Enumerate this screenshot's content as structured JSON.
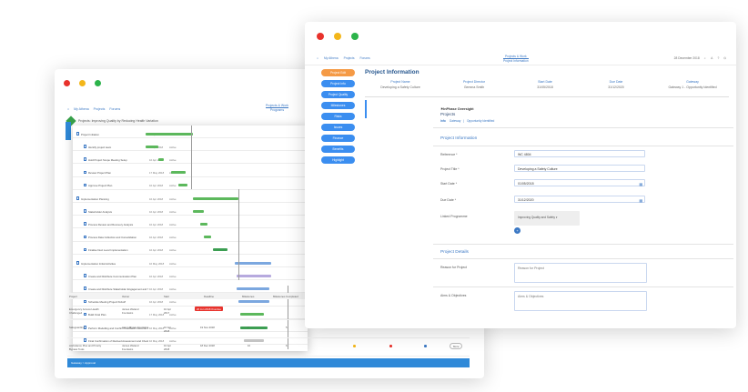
{
  "back_window": {
    "nav": [
      "My Athena",
      "Projects",
      "Forums"
    ],
    "nav_center": [
      "Projects & Work",
      "Programs"
    ],
    "title": "Projects: Improving Quality by Reducing Health Variation",
    "gantt_rows": [
      {
        "name": "Project Initiation",
        "date": "10 Apr 2018",
        "status": "Active",
        "level": 1
      },
      {
        "name": "Identify project team",
        "date": "10 Apr 2018",
        "status": "Active",
        "level": 2
      },
      {
        "name": "Hold Project Scope Meeting Setup",
        "date": "10 Apr 2018",
        "status": "Active",
        "level": 2
      },
      {
        "name": "Review Project Plan",
        "date": "17 May 2018",
        "status": "Active",
        "level": 2
      },
      {
        "name": "Approve Project Plan",
        "date": "10 Apr 2018",
        "status": "Active",
        "level": 2
      },
      {
        "name": "Implementation Planning",
        "date": "10 Apr 2018",
        "status": "Active",
        "level": 1
      },
      {
        "name": "Stakeholder Analysis",
        "date": "10 Apr 2018",
        "status": "Active",
        "level": 2
      },
      {
        "name": "Process Review and Recovery Analysis",
        "date": "10 Apr 2018",
        "status": "Active",
        "level": 2
      },
      {
        "name": "Process Data Collection and Consolidation",
        "date": "10 Apr 2018",
        "status": "Active",
        "level": 2
      },
      {
        "name": "Finalise Next Level Implementation",
        "date": "10 Apr 2018",
        "status": "Active",
        "level": 2
      },
      {
        "name": "Implementation Initial Activities",
        "date": "10 May 2018",
        "status": "Active",
        "level": 1
      },
      {
        "name": "Create and Distribute Communication Plan",
        "date": "10 Apr 2018",
        "status": "Active",
        "level": 2
      },
      {
        "name": "Create and Distribute Stakeholder Engagement and Sign-off of Current State Level Outline",
        "date": "10 Apr 2018",
        "status": "Active",
        "level": 2
      },
      {
        "name": "Schedule Meeting Project Kickoff",
        "date": "10 Apr 2018",
        "status": "Active",
        "level": 2
      },
      {
        "name": "Build Final Plan",
        "date": "17 May 2018",
        "status": "Active",
        "level": 2
      },
      {
        "name": "Perform Modelling and Confirm Feedback Outcome Provided",
        "date": "10 May 2018",
        "status": "Active",
        "level": 2
      },
      {
        "name": "Final Confirmation of Revised Assessment and Check",
        "date": "10 May 2018",
        "status": "Active",
        "level": 2
      }
    ],
    "table_headers": [
      "Project",
      "Owner",
      "Start",
      "Deadline",
      "Milestones",
      "Milestones Completed"
    ],
    "table_rows": [
      {
        "project": "Emergency Access Health Challenged",
        "owner": "James Weland Fountains",
        "start": "10 Apr 2017",
        "deadline": "20 Jun 2018 Overdue",
        "milestones": "",
        "completed": ""
      },
      {
        "project": "Safeguarding",
        "owner": "Aaron Brown Fountains",
        "start": "10 Apr 2018",
        "deadline": "19 Nov 2018",
        "milestones": "7",
        "completed": "5"
      },
      {
        "project": "Ambulance Plus and Priority Bypass Tools",
        "owner": "James Weland Fountains",
        "start": "10 Apr 2018",
        "deadline": "18 Dec 2018",
        "milestones": "10",
        "completed": "6"
      }
    ],
    "more_label": "More",
    "footer": "Gateway > Approval",
    "colors": {
      "blue": "#2f89d8",
      "green": "#5cb85c",
      "red": "#e8322c"
    }
  },
  "front_window": {
    "nav": [
      "My Athena",
      "Projects",
      "Forums"
    ],
    "nav_center": [
      "Projects & Work",
      "Project Information"
    ],
    "nav_right": [
      "28 December 2018"
    ],
    "sidebar_buttons": [
      {
        "label": "Project Edit",
        "active": true
      },
      {
        "label": "Project Info",
        "active": false
      },
      {
        "label": "Project Quality",
        "active": false
      },
      {
        "label": "Milestones",
        "active": false
      },
      {
        "label": "Risks",
        "active": false
      },
      {
        "label": "Issues",
        "active": false
      },
      {
        "label": "Finance",
        "active": false
      },
      {
        "label": "Benefits",
        "active": false
      },
      {
        "label": "Highlight",
        "active": false
      }
    ],
    "page_title": "Project Information",
    "summary": [
      {
        "key": "Project Name",
        "value": "Developing a Safety Culture"
      },
      {
        "key": "Project Director",
        "value": "Gemma Smith"
      },
      {
        "key": "Start Date",
        "value": "31/05/2018"
      },
      {
        "key": "Due Date",
        "value": "31/12/2020"
      },
      {
        "key": "Gateway",
        "value": "Gateway 1 - Opportunity Identified"
      }
    ],
    "logo": "✶InPhase Oversight",
    "section_label": "Projects",
    "breadcrumbs": [
      "Info",
      "Gateway",
      "Opportunity Identified"
    ],
    "project_info_heading": "Project Information",
    "fields": {
      "reference": {
        "label": "Reference *",
        "value": "WC 4804"
      },
      "title": {
        "label": "Project Title *",
        "value": "Developing a Safety Culture"
      },
      "start": {
        "label": "Start Date *",
        "value": "01/05/2018"
      },
      "due": {
        "label": "Due Date *",
        "value": "31/12/2020"
      },
      "programme": {
        "label": "Linked Programme",
        "value": "Improving Quality and Safety"
      }
    },
    "project_details_heading": "Project Details",
    "details": {
      "reason": {
        "label": "Reason for Project",
        "placeholder": "Reason for Project"
      },
      "aims": {
        "label": "Aims & Objectives",
        "placeholder": "Aims & Objectives"
      }
    },
    "colors": {
      "blue": "#3b8ef0",
      "orange": "#f59a45",
      "title": "#27578f"
    }
  }
}
